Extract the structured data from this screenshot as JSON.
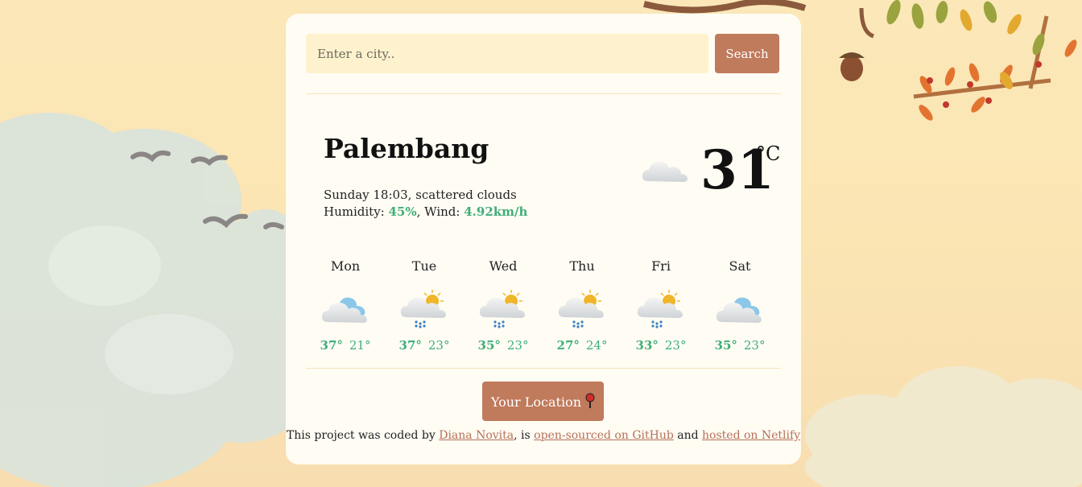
{
  "search": {
    "placeholder": "Enter a city..",
    "button_label": "Search"
  },
  "current": {
    "city": "Palembang",
    "day_time": "Sunday 18:03",
    "description": "scattered clouds",
    "humidity_label": "Humidity: ",
    "humidity": "45%",
    "wind_label": ", Wind: ",
    "wind": "4.92km/h",
    "temperature": "31",
    "unit": "°C",
    "icon": "scattered-clouds-icon"
  },
  "forecast": [
    {
      "day": "Mon",
      "max": "37°",
      "min": "21°",
      "icon": "broken-clouds-icon"
    },
    {
      "day": "Tue",
      "max": "37°",
      "min": "23°",
      "icon": "rain-sun-icon"
    },
    {
      "day": "Wed",
      "max": "35°",
      "min": "23°",
      "icon": "rain-sun-icon"
    },
    {
      "day": "Thu",
      "max": "27°",
      "min": "24°",
      "icon": "rain-sun-icon"
    },
    {
      "day": "Fri",
      "max": "33°",
      "min": "23°",
      "icon": "rain-sun-icon"
    },
    {
      "day": "Sat",
      "max": "35°",
      "min": "23°",
      "icon": "broken-clouds-icon"
    }
  ],
  "location_button": {
    "label": "Your Location",
    "icon": "pin-icon"
  },
  "footer": {
    "prefix": "This project was coded by ",
    "author": "Diana Novita",
    "middle1": ", is ",
    "github": "open-sourced on GitHub",
    "middle2": " and ",
    "netlify": "hosted on Netlify"
  },
  "colors": {
    "accent": "#c07a5c",
    "green": "#3fae7c",
    "card": "#fffcf3",
    "input": "#fdf2cd"
  }
}
